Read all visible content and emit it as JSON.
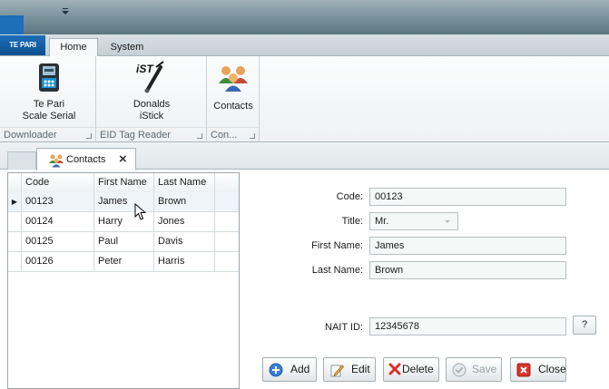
{
  "app": {
    "logo_text": "TE PARI"
  },
  "tabs": [
    {
      "label": "Home",
      "active": true
    },
    {
      "label": "System",
      "active": false
    }
  ],
  "ribbon": {
    "groups": [
      {
        "caption": "Downloader",
        "buttons": [
          {
            "label_line1": "Te Pari",
            "label_line2": "Scale Serial",
            "icon": "scale-device-icon"
          }
        ]
      },
      {
        "caption": "EID Tag Reader",
        "buttons": [
          {
            "label_line1": "Donalds",
            "label_line2": "iStick",
            "icon": "istick-reader-icon",
            "brand": "iST"
          }
        ]
      },
      {
        "caption": "Con...",
        "buttons": [
          {
            "label_line1": "Contacts",
            "label_line2": "",
            "icon": "contacts-people-icon"
          }
        ]
      }
    ]
  },
  "document_tab": {
    "label": "Contacts"
  },
  "grid": {
    "columns": [
      "Code",
      "First Name",
      "Last Name"
    ],
    "rows": [
      {
        "code": "00123",
        "first": "James",
        "last": "Brown",
        "selected": true
      },
      {
        "code": "00124",
        "first": "Harry",
        "last": "Jones",
        "selected": false
      },
      {
        "code": "00125",
        "first": "Paul",
        "last": "Davis",
        "selected": false
      },
      {
        "code": "00126",
        "first": "Peter",
        "last": "Harris",
        "selected": false
      }
    ],
    "row_indicator": "▶"
  },
  "form": {
    "code_label": "Code:",
    "code_value": "00123",
    "title_label": "Title:",
    "title_value": "Mr.",
    "first_label": "First Name:",
    "first_value": "James",
    "last_label": "Last Name:",
    "last_value": "Brown",
    "nait_label": "NAIT ID:",
    "nait_value": "12345678",
    "nait_lookup": "?"
  },
  "actions": {
    "add": "Add",
    "edit": "Edit",
    "delete": "Delete",
    "save": "Save",
    "close": "Close"
  },
  "colors": {
    "accent_blue": "#1d6fb8",
    "titlebar": "#7d969f"
  }
}
